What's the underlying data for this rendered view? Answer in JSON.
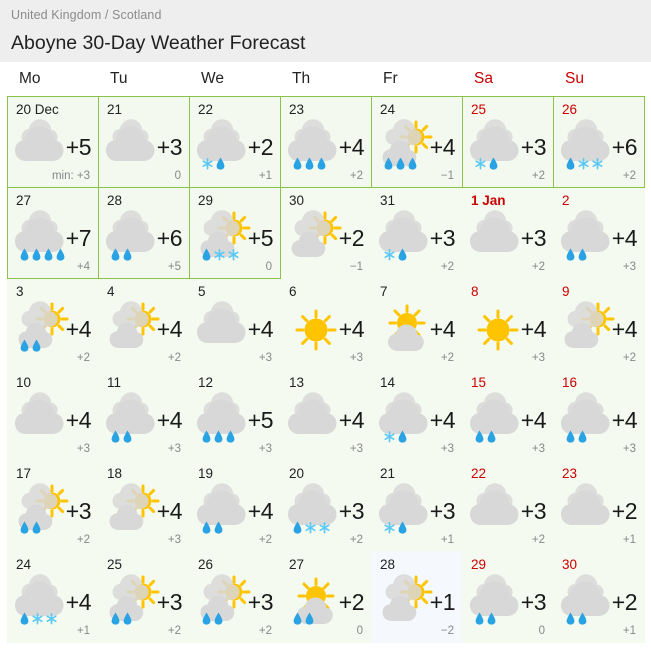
{
  "header": {
    "breadcrumb": "United Kingdom / Scotland",
    "title": "Aboyne 30-Day Weather Forecast"
  },
  "weekdays": [
    {
      "label": "Mo",
      "weekend": false
    },
    {
      "label": "Tu",
      "weekend": false
    },
    {
      "label": "We",
      "weekend": false
    },
    {
      "label": "Th",
      "weekend": false
    },
    {
      "label": "Fr",
      "weekend": false
    },
    {
      "label": "Sa",
      "weekend": true
    },
    {
      "label": "Su",
      "weekend": true
    }
  ],
  "colors": {
    "highlight_border": "#8bc34a",
    "weekend_text": "#cc0000",
    "cloud": "#d8d8d8",
    "sun": "#ffc400",
    "rain": "#29a3e3",
    "snow": "#5bc8f5",
    "header_bg": "#eeeeee",
    "cell_bg_green": "#f4faf0",
    "cell_bg_blue": "#f5f9fd"
  },
  "legend": {
    "min_prefix": "min: "
  },
  "weeks": [
    [
      {
        "daynum": "20 Dec",
        "weekend": false,
        "bold": false,
        "highlight": true,
        "bg": "green",
        "icon": "cloudy",
        "precip": [],
        "max": "+5",
        "min": "min: +3"
      },
      {
        "daynum": "21",
        "weekend": false,
        "bold": false,
        "highlight": true,
        "bg": "green",
        "icon": "cloudy",
        "precip": [],
        "max": "+3",
        "min": "0"
      },
      {
        "daynum": "22",
        "weekend": false,
        "bold": false,
        "highlight": true,
        "bg": "green",
        "icon": "cloudy",
        "precip": [
          "snow",
          "rain"
        ],
        "max": "+2",
        "min": "+1"
      },
      {
        "daynum": "23",
        "weekend": false,
        "bold": false,
        "highlight": true,
        "bg": "green",
        "icon": "cloudy",
        "precip": [
          "rain",
          "rain",
          "rain"
        ],
        "max": "+4",
        "min": "+2"
      },
      {
        "daynum": "24",
        "weekend": false,
        "bold": false,
        "highlight": true,
        "bg": "green",
        "icon": "partly",
        "precip": [
          "rain",
          "rain",
          "rain"
        ],
        "max": "+4",
        "min": "−1"
      },
      {
        "daynum": "25",
        "weekend": true,
        "bold": false,
        "highlight": true,
        "bg": "green",
        "icon": "cloudy",
        "precip": [
          "snow",
          "rain"
        ],
        "max": "+3",
        "min": "+2"
      },
      {
        "daynum": "26",
        "weekend": true,
        "bold": false,
        "highlight": true,
        "bg": "green",
        "icon": "cloudy",
        "precip": [
          "rain",
          "snow",
          "snow"
        ],
        "max": "+6",
        "min": "+2"
      }
    ],
    [
      {
        "daynum": "27",
        "weekend": false,
        "bold": false,
        "highlight": true,
        "bg": "green",
        "icon": "cloudy",
        "precip": [
          "rain",
          "rain",
          "rain",
          "rain"
        ],
        "max": "+7",
        "min": "+4"
      },
      {
        "daynum": "28",
        "weekend": false,
        "bold": false,
        "highlight": true,
        "bg": "green",
        "icon": "cloudy",
        "precip": [
          "rain",
          "rain"
        ],
        "max": "+6",
        "min": "+5"
      },
      {
        "daynum": "29",
        "weekend": false,
        "bold": false,
        "highlight": true,
        "bg": "green",
        "icon": "partly",
        "precip": [
          "rain",
          "snow",
          "snow"
        ],
        "max": "+5",
        "min": "0"
      },
      {
        "daynum": "30",
        "weekend": false,
        "bold": false,
        "highlight": false,
        "bg": "green",
        "icon": "partly",
        "precip": [],
        "max": "+2",
        "min": "−1"
      },
      {
        "daynum": "31",
        "weekend": false,
        "bold": false,
        "highlight": false,
        "bg": "green",
        "icon": "cloudy",
        "precip": [
          "snow",
          "rain"
        ],
        "max": "+3",
        "min": "+2"
      },
      {
        "daynum": "1 Jan",
        "weekend": true,
        "bold": true,
        "highlight": false,
        "bg": "green",
        "icon": "cloudy",
        "precip": [],
        "max": "+3",
        "min": "+2"
      },
      {
        "daynum": "2",
        "weekend": true,
        "bold": false,
        "highlight": false,
        "bg": "green",
        "icon": "cloudy",
        "precip": [
          "rain",
          "rain"
        ],
        "max": "+4",
        "min": "+3"
      }
    ],
    [
      {
        "daynum": "3",
        "weekend": false,
        "bold": false,
        "highlight": false,
        "bg": "green",
        "icon": "partly",
        "precip": [
          "rain",
          "rain"
        ],
        "max": "+4",
        "min": "+2"
      },
      {
        "daynum": "4",
        "weekend": false,
        "bold": false,
        "highlight": false,
        "bg": "green",
        "icon": "partly",
        "precip": [],
        "max": "+4",
        "min": "+2"
      },
      {
        "daynum": "5",
        "weekend": false,
        "bold": false,
        "highlight": false,
        "bg": "green",
        "icon": "cloudy",
        "precip": [],
        "max": "+4",
        "min": "+3"
      },
      {
        "daynum": "6",
        "weekend": false,
        "bold": false,
        "highlight": false,
        "bg": "green",
        "icon": "sunny",
        "precip": [],
        "max": "+4",
        "min": "+3"
      },
      {
        "daynum": "7",
        "weekend": false,
        "bold": false,
        "highlight": false,
        "bg": "green",
        "icon": "mostly-sunny",
        "precip": [],
        "max": "+4",
        "min": "+2"
      },
      {
        "daynum": "8",
        "weekend": true,
        "bold": false,
        "highlight": false,
        "bg": "green",
        "icon": "sunny",
        "precip": [],
        "max": "+4",
        "min": "+3"
      },
      {
        "daynum": "9",
        "weekend": true,
        "bold": false,
        "highlight": false,
        "bg": "green",
        "icon": "partly",
        "precip": [],
        "max": "+4",
        "min": "+2"
      }
    ],
    [
      {
        "daynum": "10",
        "weekend": false,
        "bold": false,
        "highlight": false,
        "bg": "green",
        "icon": "cloudy",
        "precip": [],
        "max": "+4",
        "min": "+3"
      },
      {
        "daynum": "11",
        "weekend": false,
        "bold": false,
        "highlight": false,
        "bg": "green",
        "icon": "cloudy",
        "precip": [
          "rain",
          "rain"
        ],
        "max": "+4",
        "min": "+3"
      },
      {
        "daynum": "12",
        "weekend": false,
        "bold": false,
        "highlight": false,
        "bg": "green",
        "icon": "cloudy",
        "precip": [
          "rain",
          "rain",
          "rain"
        ],
        "max": "+5",
        "min": "+3"
      },
      {
        "daynum": "13",
        "weekend": false,
        "bold": false,
        "highlight": false,
        "bg": "green",
        "icon": "cloudy",
        "precip": [],
        "max": "+4",
        "min": "+3"
      },
      {
        "daynum": "14",
        "weekend": false,
        "bold": false,
        "highlight": false,
        "bg": "green",
        "icon": "cloudy",
        "precip": [
          "snow",
          "rain"
        ],
        "max": "+4",
        "min": "+3"
      },
      {
        "daynum": "15",
        "weekend": true,
        "bold": false,
        "highlight": false,
        "bg": "green",
        "icon": "cloudy",
        "precip": [
          "rain",
          "rain"
        ],
        "max": "+4",
        "min": "+3"
      },
      {
        "daynum": "16",
        "weekend": true,
        "bold": false,
        "highlight": false,
        "bg": "green",
        "icon": "cloudy",
        "precip": [
          "rain",
          "rain"
        ],
        "max": "+4",
        "min": "+3"
      }
    ],
    [
      {
        "daynum": "17",
        "weekend": false,
        "bold": false,
        "highlight": false,
        "bg": "green",
        "icon": "partly",
        "precip": [
          "rain",
          "rain"
        ],
        "max": "+3",
        "min": "+2"
      },
      {
        "daynum": "18",
        "weekend": false,
        "bold": false,
        "highlight": false,
        "bg": "green",
        "icon": "partly",
        "precip": [],
        "max": "+4",
        "min": "+3"
      },
      {
        "daynum": "19",
        "weekend": false,
        "bold": false,
        "highlight": false,
        "bg": "green",
        "icon": "cloudy",
        "precip": [
          "rain",
          "rain"
        ],
        "max": "+4",
        "min": "+2"
      },
      {
        "daynum": "20",
        "weekend": false,
        "bold": false,
        "highlight": false,
        "bg": "green",
        "icon": "cloudy",
        "precip": [
          "rain",
          "snow",
          "snow"
        ],
        "max": "+3",
        "min": "+2"
      },
      {
        "daynum": "21",
        "weekend": false,
        "bold": false,
        "highlight": false,
        "bg": "green",
        "icon": "cloudy",
        "precip": [
          "snow",
          "rain"
        ],
        "max": "+3",
        "min": "+1"
      },
      {
        "daynum": "22",
        "weekend": true,
        "bold": false,
        "highlight": false,
        "bg": "green",
        "icon": "cloudy",
        "precip": [],
        "max": "+3",
        "min": "+2"
      },
      {
        "daynum": "23",
        "weekend": true,
        "bold": false,
        "highlight": false,
        "bg": "green",
        "icon": "cloudy",
        "precip": [],
        "max": "+2",
        "min": "+1"
      }
    ],
    [
      {
        "daynum": "24",
        "weekend": false,
        "bold": false,
        "highlight": false,
        "bg": "green",
        "icon": "cloudy",
        "precip": [
          "rain",
          "snow",
          "snow"
        ],
        "max": "+4",
        "min": "+1"
      },
      {
        "daynum": "25",
        "weekend": false,
        "bold": false,
        "highlight": false,
        "bg": "green",
        "icon": "partly",
        "precip": [
          "rain",
          "rain"
        ],
        "max": "+3",
        "min": "+2"
      },
      {
        "daynum": "26",
        "weekend": false,
        "bold": false,
        "highlight": false,
        "bg": "green",
        "icon": "partly",
        "precip": [
          "rain",
          "rain"
        ],
        "max": "+3",
        "min": "+2"
      },
      {
        "daynum": "27",
        "weekend": false,
        "bold": false,
        "highlight": false,
        "bg": "green",
        "icon": "mostly-sunny",
        "precip": [
          "rain",
          "rain"
        ],
        "max": "+2",
        "min": "0"
      },
      {
        "daynum": "28",
        "weekend": false,
        "bold": false,
        "highlight": false,
        "bg": "blue",
        "icon": "partly",
        "precip": [],
        "max": "+1",
        "min": "−2"
      },
      {
        "daynum": "29",
        "weekend": true,
        "bold": false,
        "highlight": false,
        "bg": "green",
        "icon": "cloudy",
        "precip": [
          "rain",
          "rain"
        ],
        "max": "+3",
        "min": "0"
      },
      {
        "daynum": "30",
        "weekend": true,
        "bold": false,
        "highlight": false,
        "bg": "green",
        "icon": "cloudy",
        "precip": [
          "rain",
          "rain"
        ],
        "max": "+2",
        "min": "+1"
      }
    ]
  ]
}
